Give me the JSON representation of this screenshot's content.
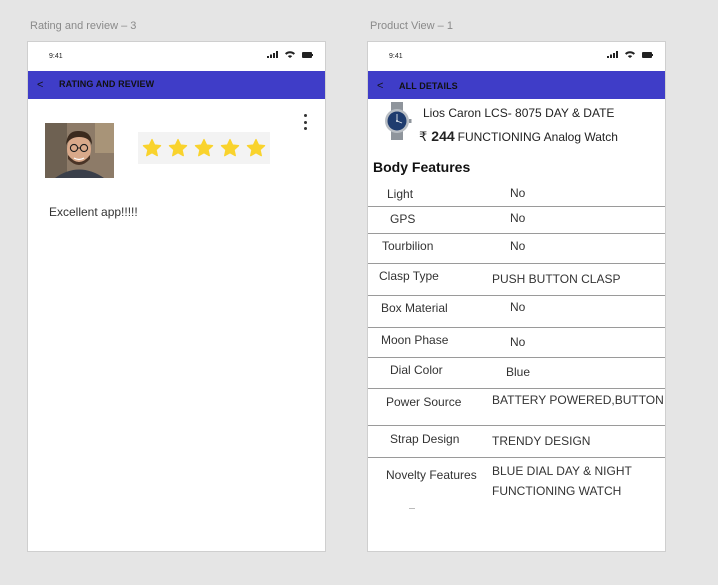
{
  "screens": {
    "rating": {
      "frame_label": "Rating and review – 3",
      "status_time": "9:41",
      "header": {
        "back_label": "<",
        "title": "RATING AND REVIEW"
      },
      "rating": {
        "stars": 5,
        "star_color": "#f9d32d"
      },
      "review_text": "Excellent app!!!!!"
    },
    "product": {
      "frame_label": "Product View – 1",
      "status_time": "9:41",
      "header": {
        "back_label": "<",
        "title": "ALL DETAILS"
      },
      "product_name": "Lios Caron LCS- 8075 DAY & DATE",
      "currency_symbol": "₹",
      "price": "244",
      "price_suffix": "FUNCTIONING Analog Watch",
      "section_title": "Body Features",
      "specs": [
        {
          "label": "Light",
          "value": "No"
        },
        {
          "label": "GPS",
          "value": "No"
        },
        {
          "label": "Tourbilion",
          "value": "No"
        },
        {
          "label": "Clasp Type",
          "value": "PUSH BUTTON CLASP"
        },
        {
          "label": "Box Material",
          "value": "No"
        },
        {
          "label": "Moon Phase",
          "value": "No"
        },
        {
          "label": "Dial Color",
          "value": "Blue"
        },
        {
          "label": "Power Source",
          "value": "BATTERY POWERED,BUTTON CELL"
        },
        {
          "label": "Strap Design",
          "value": "TRENDY DESIGN"
        },
        {
          "label": "Novelty Features",
          "value": "BLUE DIAL DAY & NIGHT FUNCTIONING WATCH"
        }
      ]
    }
  },
  "colors": {
    "accent": "#3f3dc8",
    "background": "#e5e5e5"
  },
  "icons": [
    "signal-icon",
    "wifi-icon",
    "battery-icon",
    "back-icon",
    "star-icon",
    "more-vert-icon",
    "rupee-icon"
  ]
}
